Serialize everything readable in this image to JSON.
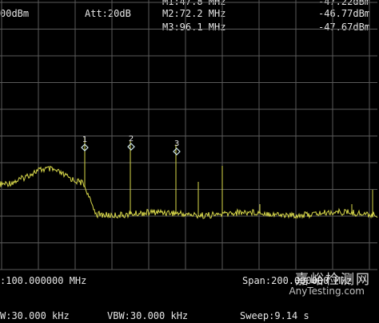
{
  "header": {
    "ref_level": "00dBm",
    "attenuation": "Att:20dB",
    "markers": [
      {
        "freq": "M1:47.8 MHz",
        "level": "-47.22dBm"
      },
      {
        "freq": "M2:72.2 MHz",
        "level": "-46.77dBm"
      },
      {
        "freq": "M3:96.1 MHz",
        "level": "-47.67dBm"
      }
    ]
  },
  "marker_labels": [
    "1",
    "2",
    "3"
  ],
  "footer": {
    "center": ":100.000000 MHz",
    "span": "Span:200.000000 MHz",
    "rbw": "W:30.000 kHz",
    "vbw": "VBW:30.000 kHz",
    "sweep": "Sweep:9.14 s"
  },
  "watermark": {
    "brand": "嘉峪检测网",
    "site": "AnyTesting.com"
  },
  "colors": {
    "background": "#000000",
    "grid": "#5a5a5a",
    "trace": "#d8d84a",
    "marker": "#cfe8ee",
    "text": "#e6e6e6"
  }
}
